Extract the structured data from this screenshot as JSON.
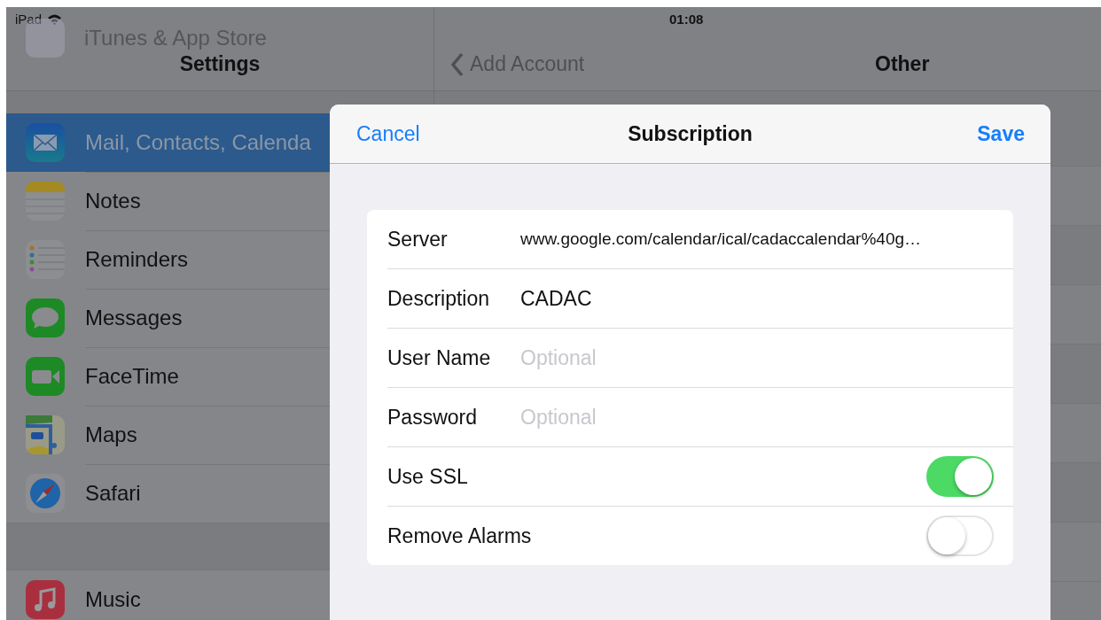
{
  "status_bar": {
    "device": "iPad",
    "time": "01:08"
  },
  "settings_pane": {
    "title": "Settings",
    "scrolled_under_item": "iTunes & App Store",
    "sections": [
      {
        "items": [
          {
            "label": "Mail, Contacts, Calenda",
            "selected": true
          },
          {
            "label": "Notes",
            "selected": false
          },
          {
            "label": "Reminders",
            "selected": false
          },
          {
            "label": "Messages",
            "selected": false
          },
          {
            "label": "FaceTime",
            "selected": false
          },
          {
            "label": "Maps",
            "selected": false
          },
          {
            "label": "Safari",
            "selected": false
          }
        ]
      },
      {
        "items": [
          {
            "label": "Music",
            "selected": false
          }
        ]
      }
    ]
  },
  "detail_pane": {
    "back": "Add Account",
    "title": "Other"
  },
  "dialog": {
    "cancel": "Cancel",
    "title": "Subscription",
    "save": "Save",
    "fields": [
      {
        "kind": "text",
        "label": "Server",
        "value": "www.google.com/calendar/ical/cadaccalendar%40g…"
      },
      {
        "kind": "text",
        "label": "Description",
        "value": "CADAC"
      },
      {
        "kind": "text",
        "label": "User Name",
        "placeholder": "Optional"
      },
      {
        "kind": "text",
        "label": "Password",
        "placeholder": "Optional"
      },
      {
        "kind": "toggle",
        "label": "Use SSL",
        "on": true
      },
      {
        "kind": "toggle",
        "label": "Remove Alarms",
        "on": false
      }
    ]
  }
}
